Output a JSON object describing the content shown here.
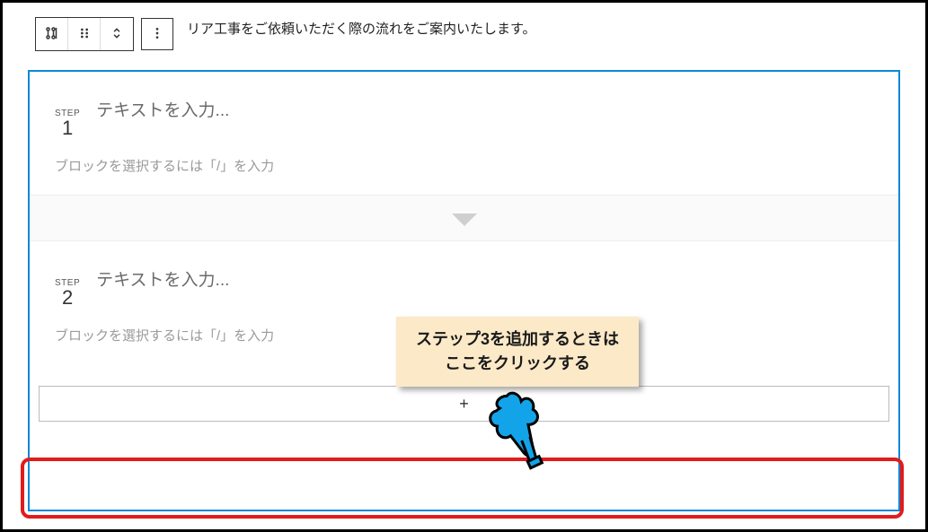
{
  "header": {
    "text": "リア工事をご依頼いただく際の流れをご案内いたします。"
  },
  "steps": [
    {
      "label": "STEP",
      "num": "1",
      "title_placeholder": "テキストを入力...",
      "body_placeholder": "ブロックを選択するには「/」を入力"
    },
    {
      "label": "STEP",
      "num": "2",
      "title_placeholder": "テキストを入力...",
      "body_placeholder": "ブロックを選択するには「/」を入力"
    }
  ],
  "add_button": "+",
  "callout": {
    "line1": "ステップ3を追加するときは",
    "line2": "ここをクリックする"
  },
  "icons": {
    "settings": "settings",
    "drag": "drag",
    "move": "move",
    "more": "more"
  }
}
